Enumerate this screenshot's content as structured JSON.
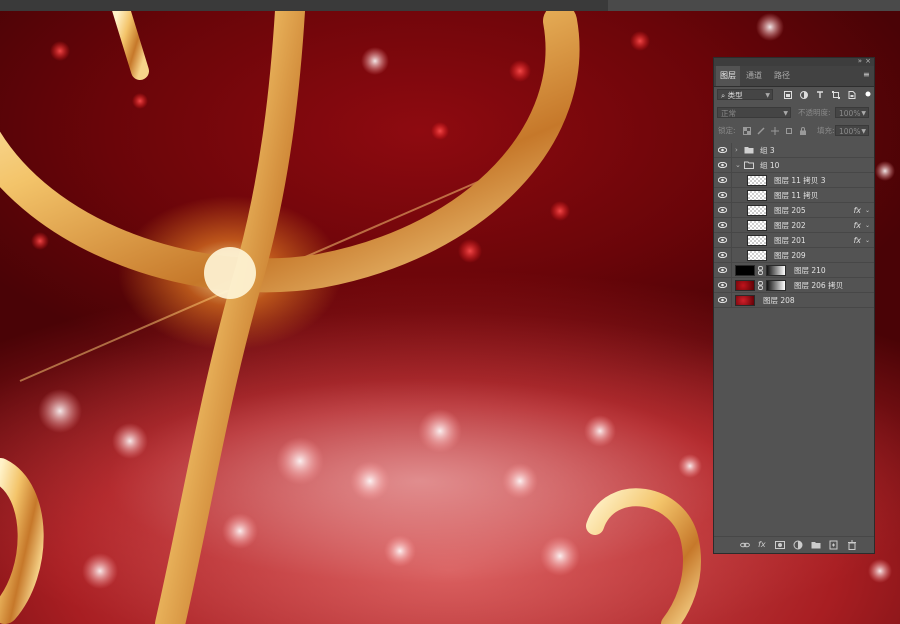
{
  "panel": {
    "tabs": [
      "图层",
      "通道",
      "路径"
    ],
    "active_tab": 0,
    "filter_kind": "类型",
    "blend_mode": "正常",
    "opacity_label": "不透明度:",
    "opacity_value": "100%",
    "lock_label": "锁定:",
    "fill_label": "填充:",
    "fill_value": "100%",
    "icons": {
      "filter": "search-icon",
      "filter_types": [
        "image-filter-icon",
        "adjustment-filter-icon",
        "type-filter-icon",
        "shape-filter-icon",
        "smart-object-filter-icon"
      ],
      "locks": [
        "lock-transparent-icon",
        "lock-image-icon",
        "lock-position-icon",
        "lock-artboard-icon",
        "lock-all-icon"
      ],
      "footer": [
        "link-layers-icon",
        "fx-icon",
        "add-mask-icon",
        "adjustment-layer-icon",
        "new-group-icon",
        "new-layer-icon",
        "delete-icon"
      ]
    }
  },
  "layers": [
    {
      "name": "组 3",
      "type": "group",
      "collapsed": true,
      "indent": 0,
      "fx": false
    },
    {
      "name": "组 10",
      "type": "group",
      "collapsed": false,
      "indent": 0,
      "fx": false
    },
    {
      "name": "图层 11 拷贝 3",
      "type": "layer",
      "indent": 1,
      "thumb": "checker",
      "fx": false
    },
    {
      "name": "图层 11 拷贝",
      "type": "layer",
      "indent": 1,
      "thumb": "checker",
      "fx": false
    },
    {
      "name": "图层 205",
      "type": "layer",
      "indent": 1,
      "thumb": "checker",
      "fx": true
    },
    {
      "name": "图层 202",
      "type": "layer",
      "indent": 1,
      "thumb": "checker",
      "fx": true
    },
    {
      "name": "图层 201",
      "type": "layer",
      "indent": 1,
      "thumb": "checker",
      "fx": true
    },
    {
      "name": "图层 209",
      "type": "layer",
      "indent": 1,
      "thumb": "checker",
      "fx": false
    },
    {
      "name": "图层 210",
      "type": "masked",
      "indent": 0,
      "thumb": "black",
      "fx": false
    },
    {
      "name": "图层 206 拷贝",
      "type": "masked",
      "indent": 0,
      "thumb": "red",
      "fx": false
    },
    {
      "name": "图层 208",
      "type": "layer",
      "indent": 0,
      "thumb": "red",
      "fx": false
    }
  ],
  "colors": {
    "panel_bg": "#535353",
    "canvas_red": "#a81e22",
    "gold": "#f0b350"
  }
}
